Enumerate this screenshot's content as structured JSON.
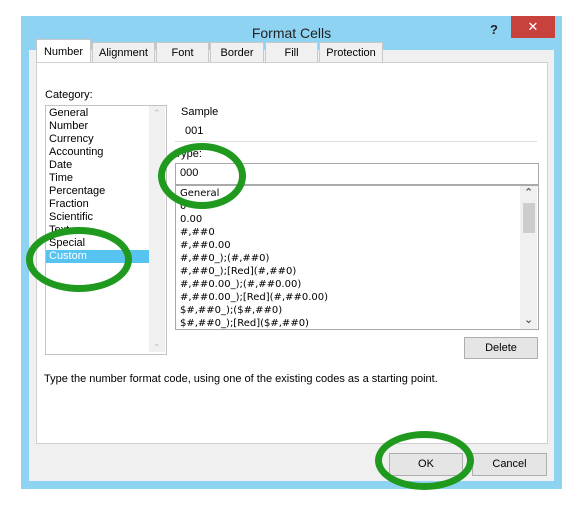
{
  "dialog": {
    "title": "Format Cells",
    "help": "?",
    "close": "✕"
  },
  "tabs": [
    {
      "label": "Number",
      "active": true
    },
    {
      "label": "Alignment"
    },
    {
      "label": "Font"
    },
    {
      "label": "Border"
    },
    {
      "label": "Fill"
    },
    {
      "label": "Protection"
    }
  ],
  "category": {
    "label": "Category:",
    "items": [
      "General",
      "Number",
      "Currency",
      "Accounting",
      "Date",
      "Time",
      "Percentage",
      "Fraction",
      "Scientific",
      "Text",
      "Special",
      "Custom"
    ],
    "selected": "Custom"
  },
  "sample": {
    "label": "Sample",
    "value": "001"
  },
  "type": {
    "label": "Type:",
    "value": "000",
    "formats": [
      "General",
      "0",
      "0.00",
      "#,##0",
      "#,##0.00",
      "#,##0_);(#,##0)",
      "#,##0_);[Red](#,##0)",
      "#,##0.00_);(#,##0.00)",
      "#,##0.00_);[Red](#,##0.00)",
      "$#,##0_);($#,##0)",
      "$#,##0_);[Red]($#,##0)"
    ]
  },
  "buttons": {
    "delete": "Delete",
    "ok": "OK",
    "cancel": "Cancel"
  },
  "hint": "Type the number format code, using one of the existing codes as a starting point.",
  "colors": {
    "title_bar": "#8fd3f3",
    "close_button": "#c9413d",
    "selection": "#56c3f0",
    "annotation": "#1f9a1f"
  }
}
